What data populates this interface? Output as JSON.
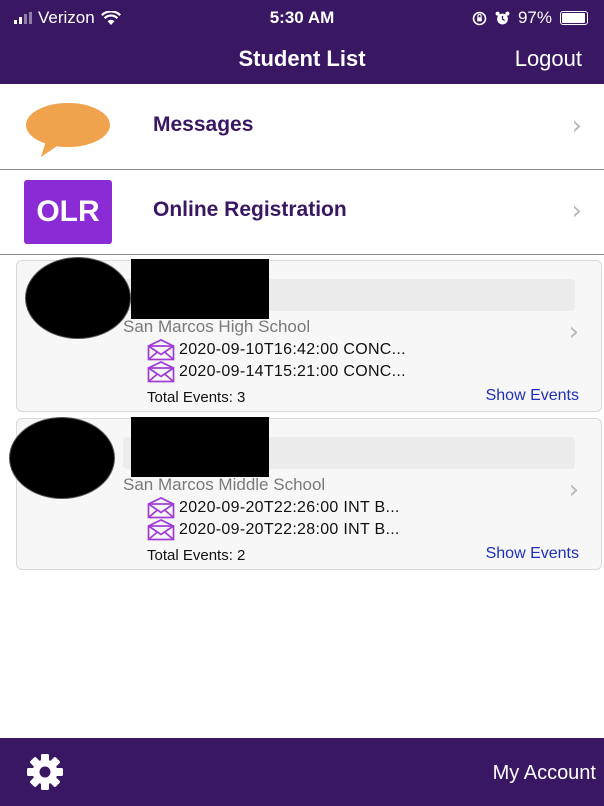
{
  "status": {
    "carrier": "Verizon",
    "time": "5:30 AM",
    "battery": "97%"
  },
  "nav": {
    "title": "Student List",
    "logout": "Logout"
  },
  "menu": [
    {
      "label": "Messages",
      "icon": "speech-bubble-icon",
      "color": "#f0a24c"
    },
    {
      "label": "Online Registration",
      "icon": "olr-icon",
      "icon_text": "OLR",
      "color": "#8b2bd6"
    }
  ],
  "students": [
    {
      "school": "San Marcos High School",
      "events": [
        "2020-09-10T16:42:00 CONC...",
        "2020-09-14T15:21:00 CONC..."
      ],
      "total": "Total Events: 3",
      "show_events": "Show Events"
    },
    {
      "school": "San Marcos Middle School",
      "events": [
        "2020-09-20T22:26:00 INT B...",
        "2020-09-20T22:28:00 INT B..."
      ],
      "total": "Total Events: 2",
      "show_events": "Show Events"
    }
  ],
  "tabbar": {
    "account": "My Account",
    "settings_icon": "gear-icon"
  },
  "colors": {
    "brand": "#3a1763",
    "link": "#1f2fb8",
    "envelope": "#a13bd6"
  }
}
